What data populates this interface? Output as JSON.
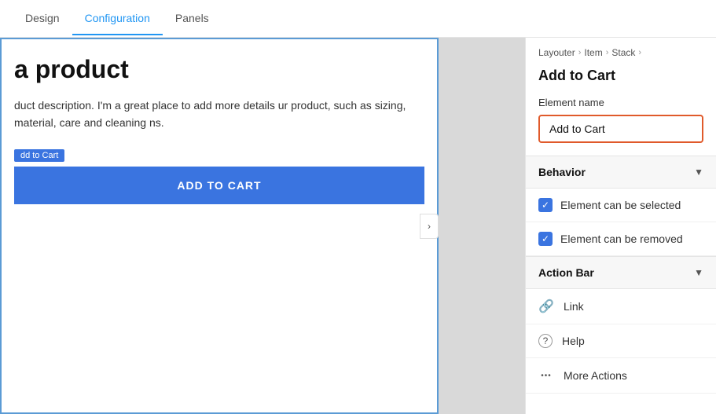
{
  "nav": {
    "tabs": [
      {
        "label": "Design",
        "active": false
      },
      {
        "label": "Configuration",
        "active": true
      },
      {
        "label": "Panels",
        "active": false
      }
    ]
  },
  "preview": {
    "product_title": "a product",
    "product_description": "duct description. I'm a great place to add more details ur product, such as sizing, material, care and cleaning ns.",
    "add_to_cart_label": "dd to Cart",
    "add_to_cart_button": "ADD TO CART",
    "collapse_icon": "›"
  },
  "panel": {
    "breadcrumb": {
      "items": [
        "Layouter",
        "Item",
        "Stack"
      ]
    },
    "title": "Add to Cart",
    "element_name_label": "Element name",
    "element_name_value": "Add to Cart",
    "behavior_section": "Behavior",
    "checkbox_selected": "Element can be selected",
    "checkbox_removed": "Element can be removed",
    "action_bar_section": "Action Bar",
    "action_items": [
      {
        "icon": "🔗",
        "label": "Link",
        "icon_name": "link-icon"
      },
      {
        "icon": "?",
        "label": "Help",
        "icon_name": "help-icon"
      },
      {
        "icon": "•••",
        "label": "More Actions",
        "icon_name": "more-actions-icon"
      }
    ]
  },
  "colors": {
    "active_tab": "#2196f3",
    "button_blue": "#3a74e0",
    "border_orange": "#e05a2b",
    "checkbox_blue": "#3a74e0"
  }
}
